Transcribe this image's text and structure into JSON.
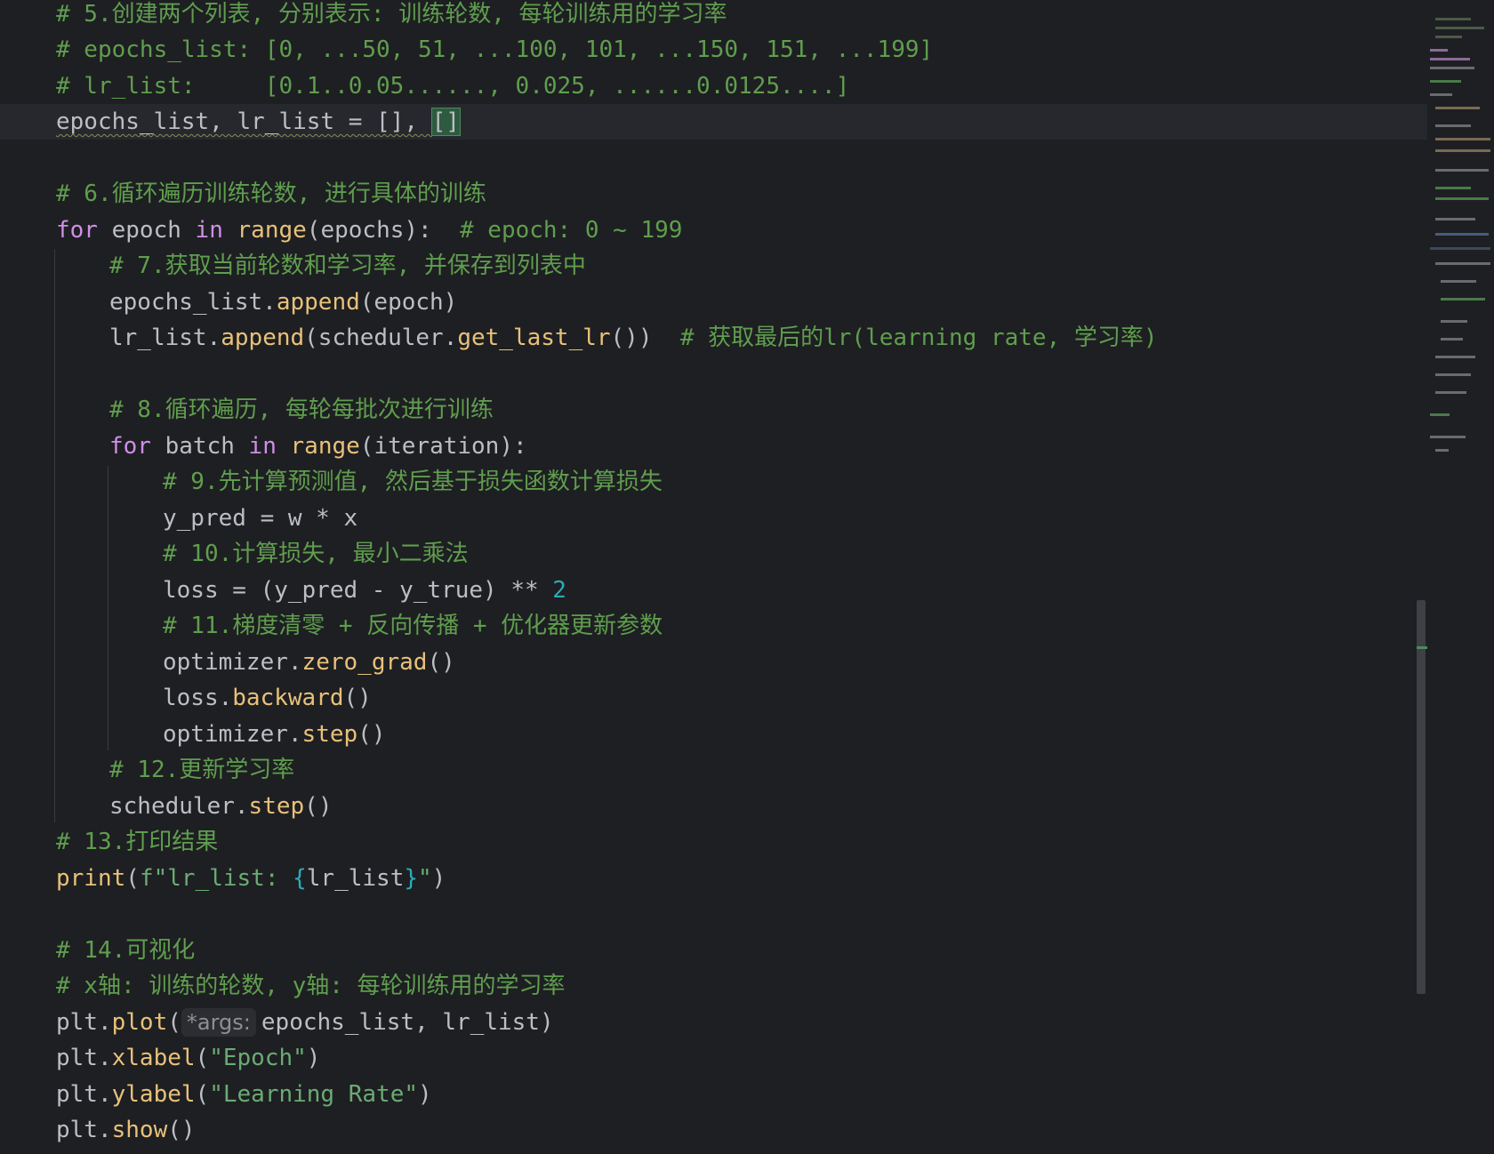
{
  "editor": {
    "lines": {
      "c5": "# 5.创建两个列表, 分别表示: 训练轮数, 每轮训练用的学习率",
      "c5a": "# epochs_list: [0, ...50, 51, ...100, 101, ...150, 151, ...199]",
      "c5b": "# lr_list:     [0.1..0.05......, 0.025, ......0.0125....]",
      "l4_a": "epochs_list, lr_list = [], ",
      "l4_b": "[]",
      "c6": "# 6.循环遍历训练轮数, 进行具体的训练",
      "l6_for": "for",
      "l6_var": " epoch ",
      "l6_in": "in",
      "l6_sp": " ",
      "l6_range": "range",
      "l6_args": "(epochs):  ",
      "l6_cm": "# epoch: 0 ~ 199",
      "c7": "# 7.获取当前轮数和学习率, 并保存到列表中",
      "l8_obj": "epochs_list.",
      "l8_fn": "append",
      "l8_args": "(epoch)",
      "l9_obj": "lr_list.",
      "l9_fn": "append",
      "l9_mid": "(scheduler.",
      "l9_fn2": "get_last_lr",
      "l9_end": "())  ",
      "l9_cm": "# 获取最后的lr(learning rate, 学习率)",
      "c8": "# 8.循环遍历, 每轮每批次进行训练",
      "l11_for": "for",
      "l11_var": " batch ",
      "l11_in": "in",
      "l11_sp": " ",
      "l11_range": "range",
      "l11_args": "(iteration):",
      "c9": "# 9.先计算预测值, 然后基于损失函数计算损失",
      "l13": "y_pred = w * x",
      "c10": "# 10.计算损失, 最小二乘法",
      "l15_a": "loss = (y_pred - y_true) ** ",
      "l15_num": "2",
      "c11": "# 11.梯度清零 + 反向传播 + 优化器更新参数",
      "l17_obj": "optimizer.",
      "l17_fn": "zero_grad",
      "l17_end": "()",
      "l18_obj": "loss.",
      "l18_fn": "backward",
      "l18_end": "()",
      "l19_obj": "optimizer.",
      "l19_fn": "step",
      "l19_end": "()",
      "c12": "# 12.更新学习率",
      "l21_obj": "scheduler.",
      "l21_fn": "step",
      "l21_end": "()",
      "c13": "# 13.打印结果",
      "l23_fn": "print",
      "l23_a": "(",
      "l23_str1": "f\"lr_list: ",
      "l23_b1": "{",
      "l23_var": "lr_list",
      "l23_b2": "}",
      "l23_str2": "\"",
      "l23_end": ")",
      "c14": "# 14.可视化",
      "c14a": "# x轴: 训练的轮数, y轴: 每轮训练用的学习率",
      "l26_obj": "plt.",
      "l26_fn": "plot",
      "l26_a": "(",
      "l26_hint": "*args:",
      "l26_args": "epochs_list, lr_list)",
      "l27_obj": "plt.",
      "l27_fn": "xlabel",
      "l27_a": "(",
      "l27_str": "\"Epoch\"",
      "l27_end": ")",
      "l28_obj": "plt.",
      "l28_fn": "ylabel",
      "l28_a": "(",
      "l28_str": "\"Learning Rate\"",
      "l28_end": ")",
      "l29_obj": "plt.",
      "l29_fn": "show",
      "l29_end": "()"
    }
  },
  "colors": {
    "background": "#1e1f22",
    "comment": "#5f9e4e",
    "keyword": "#cf8ee8",
    "function": "#e8c17a",
    "number": "#2aacb8",
    "string": "#6aab73",
    "text": "#bcbec4"
  }
}
